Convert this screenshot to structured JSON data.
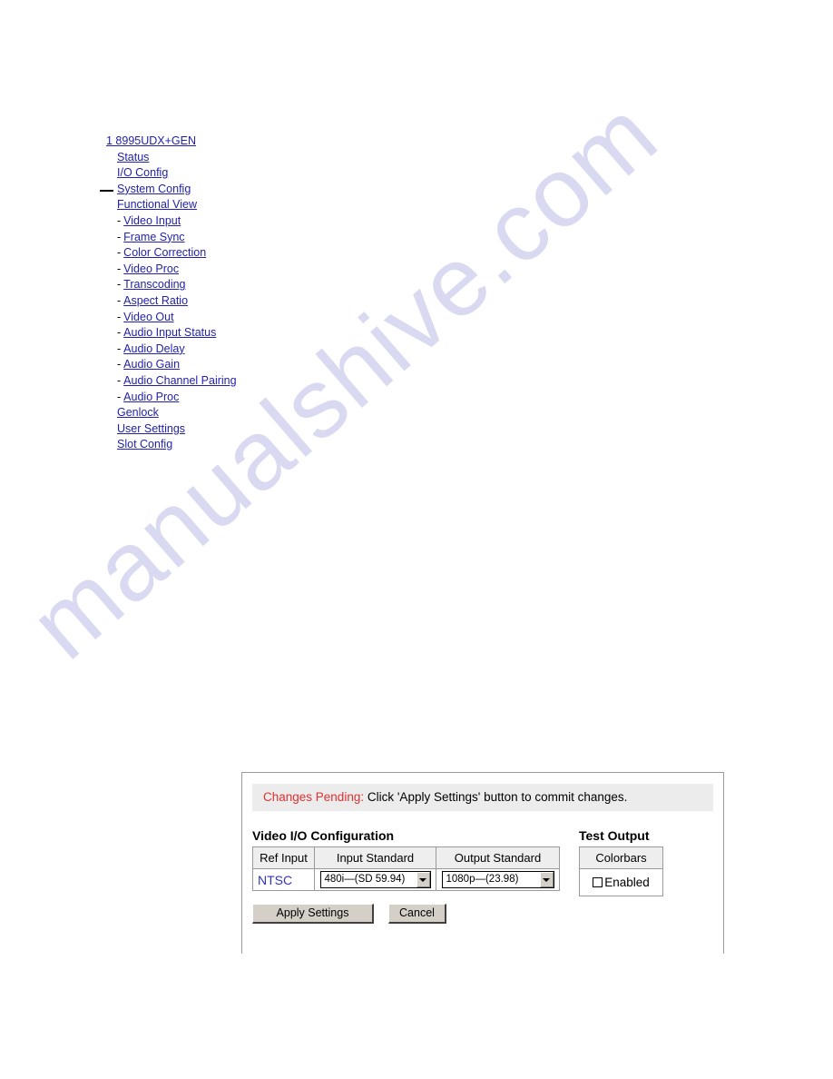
{
  "watermark": {
    "text": "manualshive.com",
    "color": "#d9d9f2"
  },
  "nav_tree": {
    "selected_item": "System Config",
    "items": [
      {
        "label": "1 8995UDX+GEN",
        "indent": 0,
        "bullet": "",
        "selected": false
      },
      {
        "label": "Status",
        "indent": 1,
        "bullet": "",
        "selected": false
      },
      {
        "label": "I/O Config",
        "indent": 1,
        "bullet": "",
        "selected": false
      },
      {
        "label": "System Config",
        "indent": 1,
        "bullet": "",
        "selected": true
      },
      {
        "label": "Functional View",
        "indent": 1,
        "bullet": "",
        "selected": false
      },
      {
        "label": "Video Input",
        "indent": 2,
        "bullet": "-",
        "selected": false
      },
      {
        "label": "Frame Sync",
        "indent": 2,
        "bullet": "-",
        "selected": false
      },
      {
        "label": "Color Correction",
        "indent": 2,
        "bullet": "-",
        "selected": false
      },
      {
        "label": "Video Proc",
        "indent": 2,
        "bullet": "-",
        "selected": false
      },
      {
        "label": "Transcoding",
        "indent": 2,
        "bullet": "-",
        "selected": false
      },
      {
        "label": "Aspect Ratio",
        "indent": 2,
        "bullet": "-",
        "selected": false
      },
      {
        "label": "Video Out",
        "indent": 2,
        "bullet": "-",
        "selected": false
      },
      {
        "label": "Audio Input Status",
        "indent": 2,
        "bullet": "-",
        "selected": false
      },
      {
        "label": "Audio Delay",
        "indent": 2,
        "bullet": "-",
        "selected": false
      },
      {
        "label": "Audio Gain",
        "indent": 2,
        "bullet": "-",
        "selected": false
      },
      {
        "label": "Audio Channel Pairing",
        "indent": 2,
        "bullet": "-",
        "selected": false
      },
      {
        "label": "Audio Proc",
        "indent": 2,
        "bullet": "-",
        "selected": false
      },
      {
        "label": "Genlock",
        "indent": 1,
        "bullet": "",
        "selected": false
      },
      {
        "label": "User Settings",
        "indent": 1,
        "bullet": "",
        "selected": false
      },
      {
        "label": "Slot Config",
        "indent": 1,
        "bullet": "",
        "selected": false
      }
    ]
  },
  "panel": {
    "banner": {
      "label": "Changes Pending:",
      "label_color": "#e03030",
      "message": "Click 'Apply Settings' button to commit changes."
    },
    "video_io": {
      "title": "Video I/O Configuration",
      "headers": [
        "Ref Input",
        "Input Standard",
        "Output Standard"
      ],
      "ref_input_value": "NTSC",
      "input_standard_value": "480i—(SD 59.94)",
      "output_standard_value": "1080p—(23.98)"
    },
    "test_output": {
      "title": "Test Output",
      "header": "Colorbars",
      "checkbox_label": "Enabled",
      "checked": false
    },
    "buttons": {
      "apply": "Apply Settings",
      "cancel": "Cancel"
    }
  }
}
